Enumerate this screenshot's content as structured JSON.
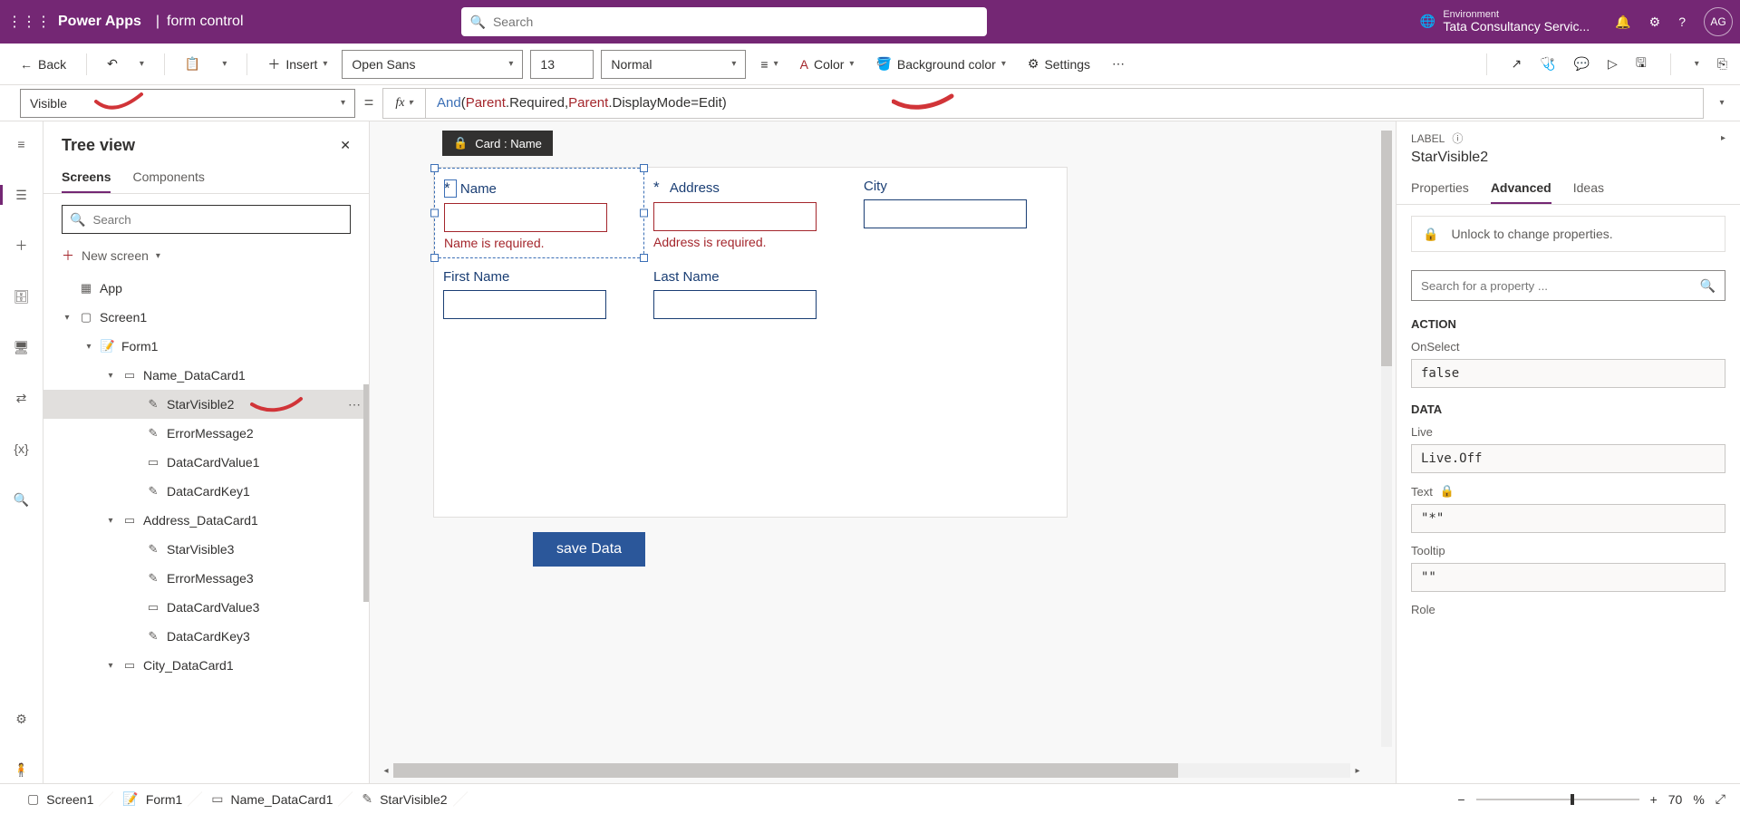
{
  "topbar": {
    "brand": "Power Apps",
    "title": "form control",
    "search_placeholder": "Search",
    "env_label": "Environment",
    "env_value": "Tata Consultancy Servic...",
    "avatar": "AG"
  },
  "cmdbar": {
    "back": "Back",
    "insert": "Insert",
    "font_name": "Open Sans",
    "font_size": "13",
    "font_weight": "Normal",
    "color": "Color",
    "bgcolor": "Background color",
    "settings": "Settings"
  },
  "formula": {
    "property": "Visible",
    "fn": "And",
    "id1": "Parent",
    "id2": "Parent",
    "seg1": ".Required, ",
    "seg2": ".DisplayMode=Edit)",
    "open": "("
  },
  "tree": {
    "title": "Tree view",
    "tab_screens": "Screens",
    "tab_components": "Components",
    "search_placeholder": "Search",
    "new_screen": "New screen",
    "nodes": {
      "app": "App",
      "screen1": "Screen1",
      "form1": "Form1",
      "name_dc": "Name_DataCard1",
      "starvis2": "StarVisible2",
      "errmsg2": "ErrorMessage2",
      "dcval1": "DataCardValue1",
      "dckey1": "DataCardKey1",
      "addr_dc": "Address_DataCard1",
      "starvis3": "StarVisible3",
      "errmsg3": "ErrorMessage3",
      "dcval3": "DataCardValue3",
      "dckey3": "DataCardKey3",
      "city_dc": "City_DataCard1"
    }
  },
  "canvas": {
    "card_tooltip": "Card : Name",
    "name_star": "*",
    "name_label": "Name",
    "name_error": "Name is required.",
    "addr_star": "*",
    "addr_label": "Address",
    "addr_error": "Address is required.",
    "city_label": "City",
    "first_label": "First Name",
    "last_label": "Last Name",
    "save_btn": "save Data"
  },
  "props": {
    "type": "LABEL",
    "name": "StarVisible2",
    "tab_properties": "Properties",
    "tab_advanced": "Advanced",
    "tab_ideas": "Ideas",
    "unlock": "Unlock to change properties.",
    "search_placeholder": "Search for a property ...",
    "sect_action": "ACTION",
    "onselect_lbl": "OnSelect",
    "onselect_val": "false",
    "sect_data": "DATA",
    "live_lbl": "Live",
    "live_val": "Live.Off",
    "text_lbl": "Text",
    "text_val": "\"*\"",
    "tooltip_lbl": "Tooltip",
    "tooltip_val": "\"\"",
    "role_lbl": "Role"
  },
  "status": {
    "screen1": "Screen1",
    "form1": "Form1",
    "name_dc": "Name_DataCard1",
    "starvis2": "StarVisible2",
    "zoom": "70",
    "zoom_pct": "%"
  }
}
